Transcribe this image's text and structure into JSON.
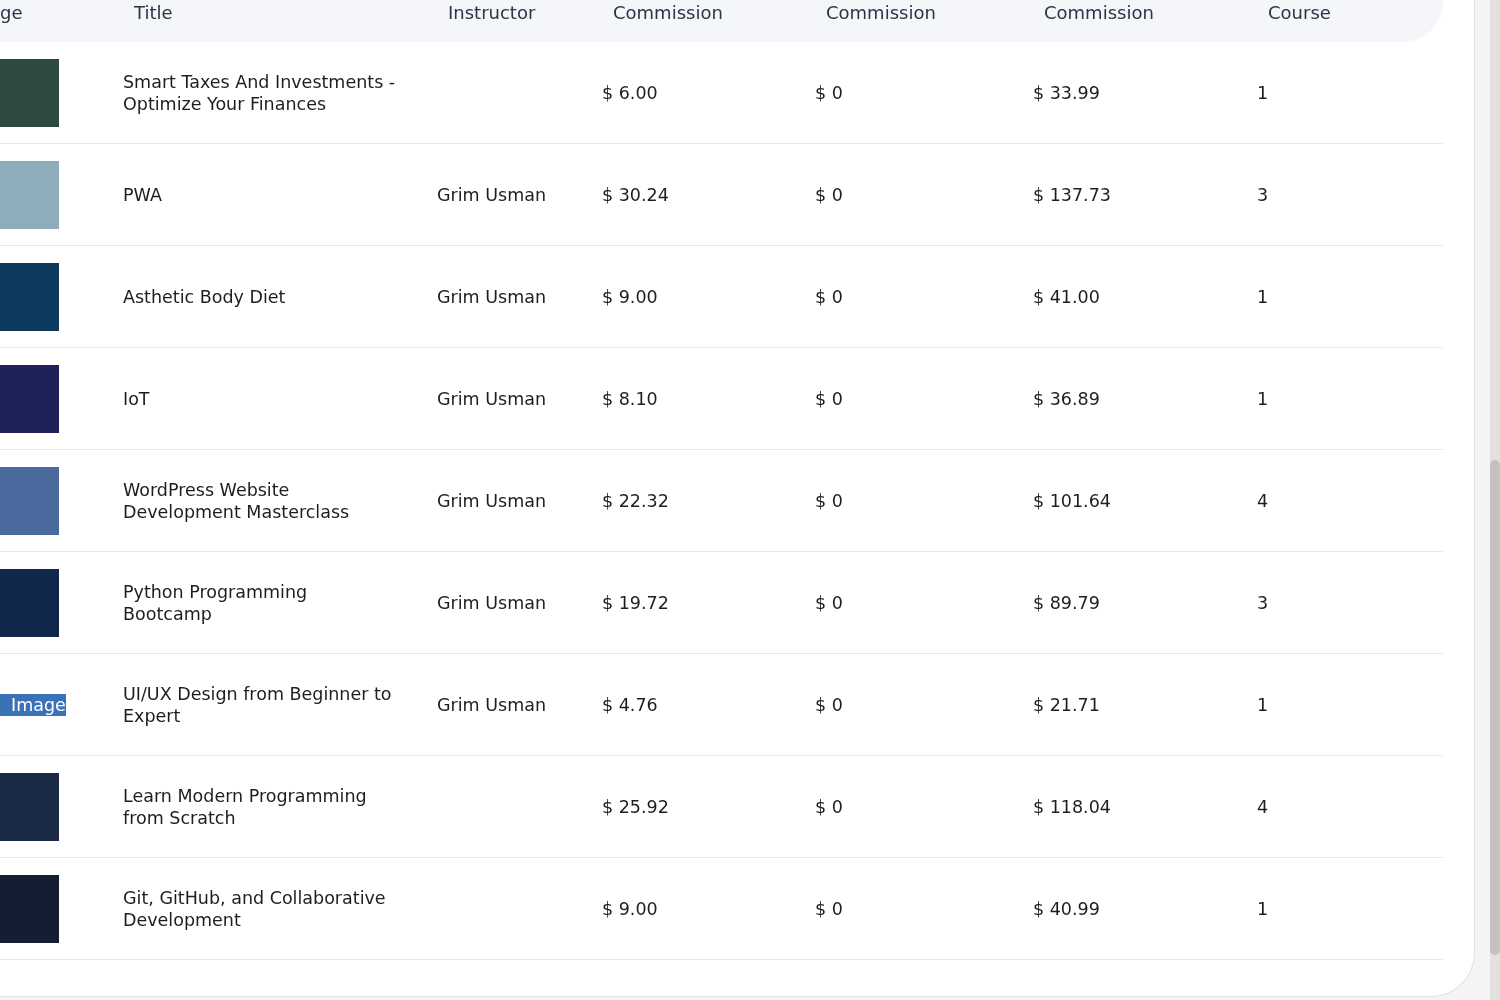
{
  "table": {
    "columns": [
      "ge",
      "Title",
      "Instructor",
      "Commission",
      "Commission",
      "Commission",
      "Course"
    ],
    "rows": [
      {
        "image": {
          "kind": "photo"
        },
        "title": "Smart Taxes And Investments - Optimize Your Finances",
        "commission_1": "$ 6.00",
        "commission_2": "$ 0",
        "commission_3": "$ 33.99",
        "course": "1"
      },
      {
        "image": {
          "kind": "photo"
        },
        "title": "PWA",
        "instructor": "Grim Usman",
        "commission_1": "$ 30.24",
        "commission_2": "$ 0",
        "commission_3": "$ 137.73",
        "course": "3"
      },
      {
        "image": {
          "kind": "photo"
        },
        "title": "Asthetic Body Diet",
        "instructor": "Grim Usman",
        "commission_1": "$ 9.00",
        "commission_2": "$ 0",
        "commission_3": "$ 41.00",
        "course": "1"
      },
      {
        "image": {
          "kind": "photo"
        },
        "title": "IoT",
        "instructor": "Grim Usman",
        "commission_1": "$ 8.10",
        "commission_2": "$ 0",
        "commission_3": "$ 36.89",
        "course": "1"
      },
      {
        "image": {
          "kind": "photo"
        },
        "title": "WordPress Website Development Masterclass",
        "instructor": "Grim Usman",
        "commission_1": "$ 22.32",
        "commission_2": "$ 0",
        "commission_3": "$ 101.64",
        "course": "4"
      },
      {
        "image": {
          "kind": "photo"
        },
        "title": "Python Programming Bootcamp",
        "instructor": "Grim Usman",
        "commission_1": "$ 19.72",
        "commission_2": "$ 0",
        "commission_3": "$ 89.79",
        "course": "3"
      },
      {
        "image": {
          "kind": "missing",
          "alt": "Image"
        },
        "title": "UI/UX Design from Beginner to Expert",
        "instructor": "Grim Usman",
        "commission_1": "$ 4.76",
        "commission_2": "$ 0",
        "commission_3": "$ 21.71",
        "course": "1"
      },
      {
        "image": {
          "kind": "photo"
        },
        "title": "Learn Modern Programming from Scratch",
        "commission_1": "$ 25.92",
        "commission_2": "$ 0",
        "commission_3": "$ 118.04",
        "course": "4"
      },
      {
        "image": {
          "kind": "photo"
        },
        "title": "Git, GitHub, and Collaborative Development",
        "commission_1": "$ 9.00",
        "commission_2": "$ 0",
        "commission_3": "$ 40.99",
        "course": "1"
      }
    ]
  }
}
